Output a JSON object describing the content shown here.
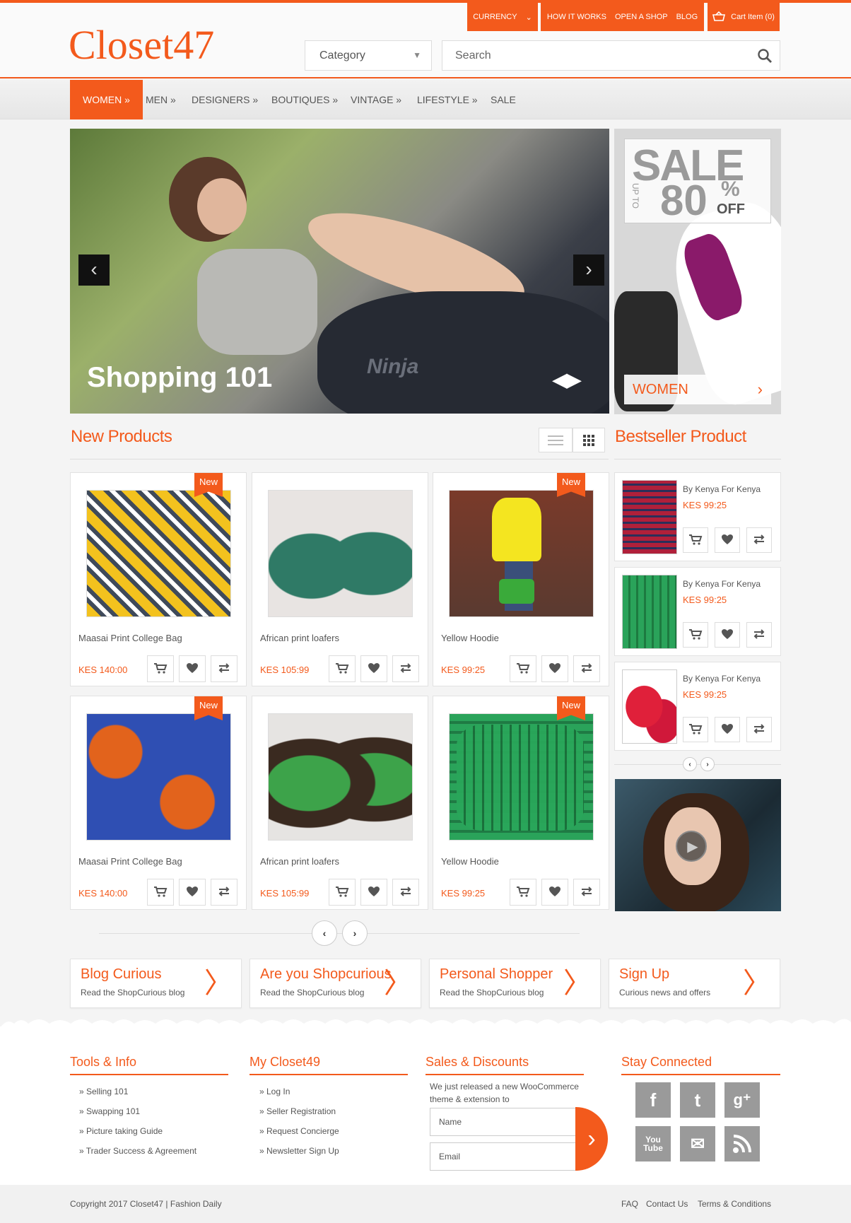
{
  "brand": {
    "logo": "Closet47",
    "accent": "#f35a1c"
  },
  "topnav": {
    "currency": "CURRENCY",
    "how": "HOW IT WORKS",
    "open_shop": "OPEN A SHOP",
    "blog": "BLOG",
    "cart": "Cart Item (0)"
  },
  "category": {
    "label": "Category"
  },
  "search": {
    "placeholder": "Search"
  },
  "nav": [
    "WOMEN »",
    "MEN »",
    "DESIGNERS »",
    "BOUTIQUES »",
    "VINTAGE »",
    "LIFESTYLE »",
    "SALE"
  ],
  "hero": {
    "title": "Shopping 101",
    "bike_text": "Ninja"
  },
  "sale_banner": {
    "sale": "SALE",
    "upto": "UP TO",
    "percent": "80",
    "pct_sign": "%",
    "off": "OFF",
    "button": "WOMEN"
  },
  "new_products": {
    "title": "New Products",
    "badge": "New",
    "items": [
      {
        "name": "Maasai Print College Bag",
        "price": "KES 140:00"
      },
      {
        "name": "African print loafers",
        "price": "KES 105:99"
      },
      {
        "name": "Yellow Hoodie",
        "price": "KES 99:25"
      },
      {
        "name": "Maasai Print College Bag",
        "price": "KES 140:00"
      },
      {
        "name": "African print loafers",
        "price": "KES 105:99"
      },
      {
        "name": "Yellow Hoodie",
        "price": "KES 99:25"
      }
    ]
  },
  "bestseller": {
    "title": "Bestseller Product",
    "items": [
      {
        "by": "By Kenya For Kenya",
        "price": "KES 99:25"
      },
      {
        "by": "By Kenya For Kenya",
        "price": "KES 99:25"
      },
      {
        "by": "By Kenya For Kenya",
        "price": "KES 99:25"
      }
    ]
  },
  "promos": [
    {
      "title": "Blog Curious",
      "sub": "Read the ShopCurious blog"
    },
    {
      "title": "Are you Shopcurious",
      "sub": "Read the ShopCurious blog"
    },
    {
      "title": "Personal Shopper",
      "sub": "Read the ShopCurious blog"
    },
    {
      "title": "Sign Up",
      "sub": "Curious news and offers"
    }
  ],
  "footer": {
    "tools": {
      "title": "Tools & Info",
      "links": [
        "» Selling 101",
        "» Swapping 101",
        "» Picture taking Guide",
        "» Trader Success & Agreement"
      ]
    },
    "my": {
      "title": "My Closet49",
      "links": [
        "» Log In",
        "» Seller Registration",
        "» Request Concierge",
        "» Newsletter Sign Up"
      ]
    },
    "sales": {
      "title": "Sales & Discounts",
      "text": "We just released a new WooCommerce theme & extension to",
      "name_placeholder": "Name",
      "email_placeholder": "Email"
    },
    "social": {
      "title": "Stay Connected",
      "icons": [
        "facebook-icon",
        "twitter-icon",
        "google-plus-icon",
        "youtube-icon",
        "email-icon",
        "rss-icon"
      ],
      "youtube_text": "You Tube"
    }
  },
  "copyright": {
    "text": "Copyright 2017 Closet47 | Fashion Daily",
    "links": [
      "FAQ",
      "Contact Us",
      "Terms & Conditions"
    ]
  }
}
